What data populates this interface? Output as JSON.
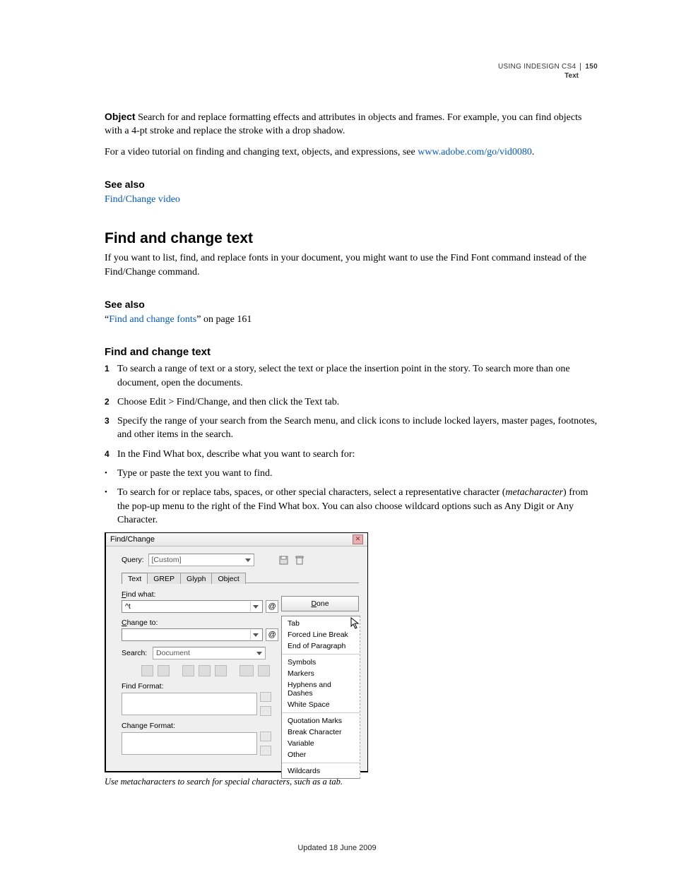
{
  "runhead": {
    "product": "USING INDESIGN CS4",
    "pagenum": "150",
    "section": "Text"
  },
  "p_object_label": "Object",
  "p_object": "  Search for and replace formatting effects and attributes in objects and frames. For example, you can find objects with a 4-pt stroke and replace the stroke with a drop shadow.",
  "p_video_pre": "For a video tutorial on finding and changing text, objects, and expressions, see ",
  "p_video_link": "www.adobe.com/go/vid0080",
  "p_video_post": ".",
  "see_also": "See also",
  "link_fc_video": "Find/Change video",
  "h1": "Find and change text",
  "p_h1_body": "If you want to list, find, and replace fonts in your document, you might want to use the Find Font command instead of the Find/Change command.",
  "see_also2_pre": "“",
  "see_also2_link": "Find and change fonts",
  "see_also2_post": "” on page 161",
  "h2": "Find and change text",
  "steps": [
    "To search a range of text or a story, select the text or place the insertion point in the story. To search more than one document, open the documents.",
    "Choose Edit > Find/Change, and then click the Text tab.",
    "Specify the range of your search from the Search menu, and click icons to include locked layers, master pages, footnotes, and other items in the search.",
    "In the Find What box, describe what you want to search for:"
  ],
  "bullets": [
    {
      "plain": "Type or paste the text you want to find."
    },
    {
      "pre": "To search for or replace tabs, spaces, or other special characters, select a representative character (",
      "ital": "metacharacter",
      "post": ") from the pop-up menu to the right of the Find What box. You can also choose wildcard options such as Any Digit or Any Character."
    }
  ],
  "dialog": {
    "title": "Find/Change",
    "query_label": "Query:",
    "query_value": "[Custom]",
    "tabs": [
      "Text",
      "GREP",
      "Glyph",
      "Object"
    ],
    "find_what_label_u": "F",
    "find_what_label_rest": "ind what:",
    "find_what_value": "^t",
    "change_to_label_u": "C",
    "change_to_label_rest": "hange to:",
    "search_label_u": "S",
    "search_label_rest": "earch:",
    "search_value": "Document",
    "find_format_label": "Find Format:",
    "change_format_label": "Change Format:",
    "done_u": "D",
    "done_rest": "one",
    "menu": [
      "Tab",
      "Forced Line Break",
      "End of Paragraph",
      "",
      "Symbols",
      "Markers",
      "Hyphens and Dashes",
      "White Space",
      "",
      "Quotation Marks",
      "Break Character",
      "Variable",
      "Other",
      "",
      "Wildcards"
    ]
  },
  "caption": "Use metacharacters to search for special characters, such as a tab.",
  "footer": "Updated 18 June 2009"
}
